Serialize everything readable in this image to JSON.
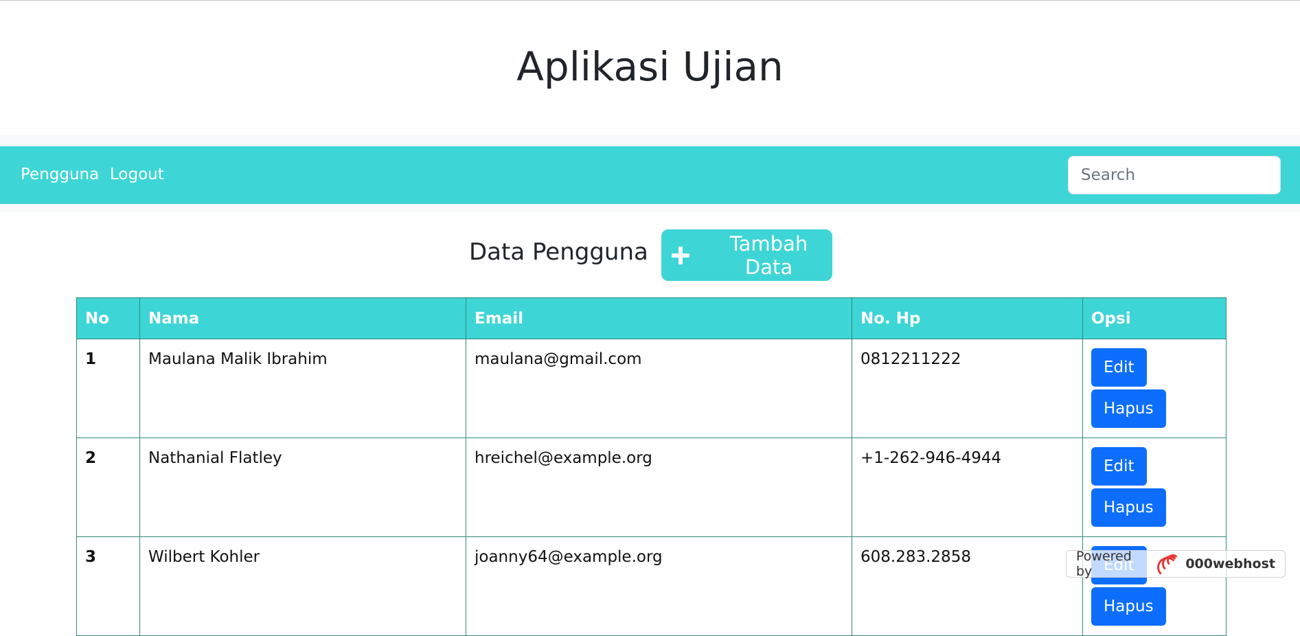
{
  "header": {
    "title": "Aplikasi Ujian"
  },
  "navbar": {
    "links": [
      {
        "label": "Pengguna"
      },
      {
        "label": "Logout"
      }
    ],
    "search": {
      "placeholder": "Search",
      "value": ""
    }
  },
  "main": {
    "section_title": "Data Pengguna",
    "add_button_label": "Tambah Data",
    "table": {
      "headers": [
        "No",
        "Nama",
        "Email",
        "No. Hp",
        "Opsi"
      ],
      "rows": [
        {
          "no": "1",
          "nama": "Maulana Malik Ibrahim",
          "email": "maulana@gmail.com",
          "hp": "0812211222",
          "edit": "Edit",
          "hapus": "Hapus"
        },
        {
          "no": "2",
          "nama": "Nathanial Flatley",
          "email": "hreichel@example.org",
          "hp": "+1-262-946-4944",
          "edit": "Edit",
          "hapus": "Hapus"
        },
        {
          "no": "3",
          "nama": "Wilbert Kohler",
          "email": "joanny64@example.org",
          "hp": "608.283.2858",
          "edit": "Edit",
          "hapus": "Hapus"
        }
      ]
    }
  },
  "badge": {
    "prefix": "Powered by",
    "brand": "000webhost"
  },
  "colors": {
    "accent": "#3ed5d6",
    "primary_button": "#0d6efd",
    "table_border": "#2e8b76"
  }
}
